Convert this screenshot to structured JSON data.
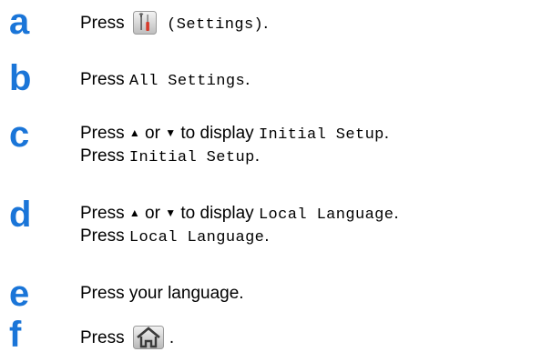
{
  "accent_color": "#1a75d8",
  "steps": [
    {
      "letter": "a",
      "lines": [
        {
          "pre": "Press",
          "icon": "settings-tools-icon",
          "code": "(Settings)",
          "post": "."
        }
      ]
    },
    {
      "letter": "b",
      "lines": [
        {
          "pre": "Press",
          "code": "All Settings",
          "post": "."
        }
      ]
    },
    {
      "letter": "c",
      "lines": [
        {
          "pre": "Press",
          "up": "▲",
          "or": "or",
          "down": "▼",
          "mid": "to display",
          "code": "Initial Setup",
          "post": "."
        },
        {
          "pre": "Press",
          "code": "Initial Setup",
          "post": "."
        }
      ]
    },
    {
      "letter": "d",
      "lines": [
        {
          "pre": "Press",
          "up": "▲",
          "or": "or",
          "down": "▼",
          "mid": "to display",
          "code": "Local Language",
          "post": "."
        },
        {
          "pre": "Press",
          "code": "Local Language",
          "post": "."
        }
      ]
    },
    {
      "letter": "e",
      "lines": [
        {
          "text": "Press your language."
        }
      ]
    },
    {
      "letter": "f",
      "lines": [
        {
          "pre": "Press",
          "icon": "home-icon",
          "post": "."
        }
      ]
    }
  ]
}
